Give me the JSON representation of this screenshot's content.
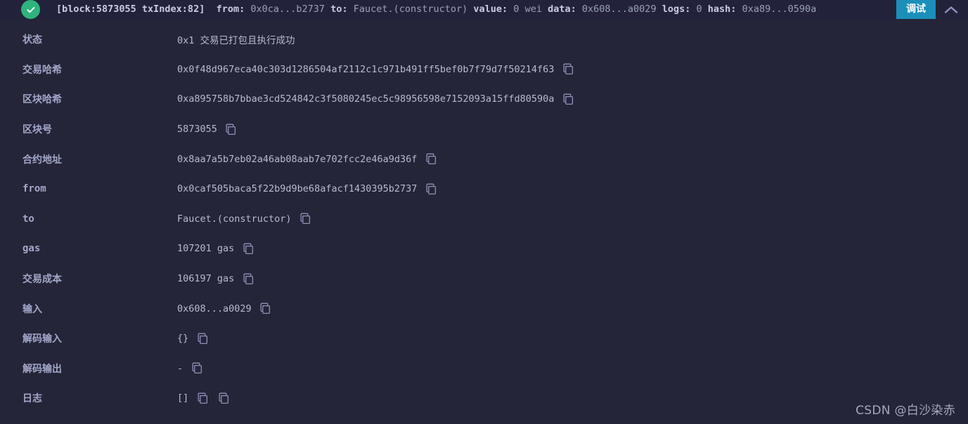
{
  "header": {
    "status_icon": "check-circle-icon",
    "summary": {
      "block_label": "[block:5873055 txIndex:82]",
      "from_label": "from:",
      "from_value": "0x0ca...b2737",
      "to_label": "to:",
      "to_value": "Faucet.(constructor)",
      "value_label": "value:",
      "value_value": "0 wei",
      "data_label": "data:",
      "data_value": "0x608...a0029",
      "logs_label": "logs:",
      "logs_value": "0",
      "hash_label": "hash:",
      "hash_value": "0xa89...0590a"
    },
    "debug_button": "调试",
    "collapse_icon": "chevron-up-icon",
    "accent_color": "#1b8fba",
    "success_color": "#2fb37d"
  },
  "rows": [
    {
      "label": "状态",
      "value": "0x1  交易已打包且执行成功",
      "copies": 0
    },
    {
      "label": "交易哈希",
      "value": "0x0f48d967eca40c303d1286504af2112c1c971b491ff5bef0b7f79d7f50214f63",
      "copies": 1
    },
    {
      "label": "区块哈希",
      "value": "0xa895758b7bbae3cd524842c3f5080245ec5c98956598e7152093a15ffd80590a",
      "copies": 1
    },
    {
      "label": "区块号",
      "value": "5873055",
      "copies": 1
    },
    {
      "label": "合约地址",
      "value": "0x8aa7a5b7eb02a46ab08aab7e702fcc2e46a9d36f",
      "copies": 1
    },
    {
      "label": "from",
      "value": "0x0caf505baca5f22b9d9be68afacf1430395b2737",
      "copies": 1
    },
    {
      "label": "to",
      "value": "Faucet.(constructor)",
      "copies": 1
    },
    {
      "label": "gas",
      "value": "107201 gas",
      "copies": 1
    },
    {
      "label": "交易成本",
      "value": "106197 gas",
      "copies": 1
    },
    {
      "label": "输入",
      "value": "0x608...a0029",
      "copies": 1
    },
    {
      "label": "解码输入",
      "value": "{}",
      "copies": 1
    },
    {
      "label": "解码输出",
      "value": "-",
      "copies": 1
    },
    {
      "label": "日志",
      "value": "[]",
      "copies": 2
    }
  ],
  "watermark": "CSDN @白沙染赤",
  "colors": {
    "background": "#242538",
    "header_background": "#22233a",
    "label_text": "#a3a7c9",
    "value_text": "#b7bad2",
    "icon_stroke": "#8f93b8"
  }
}
